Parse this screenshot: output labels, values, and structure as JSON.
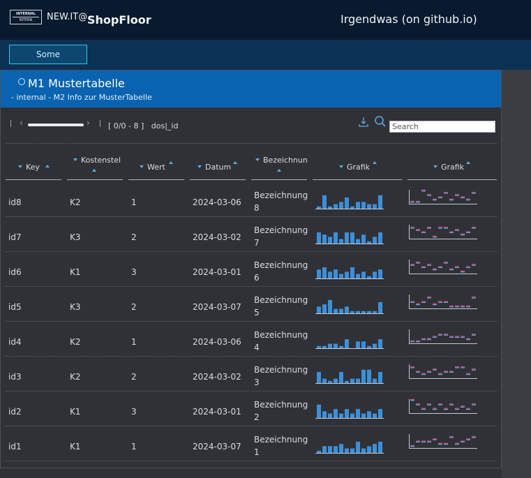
{
  "header": {
    "logo_line1": "INTERNAL",
    "logo_line2": "INTERN",
    "brand_prefix": "NEW.IT@",
    "brand_name": "ShopFloor",
    "right_title": "Irgendwas (on github.io)"
  },
  "nav": {
    "some_button": "Some"
  },
  "panel": {
    "title": "M1 Mustertabelle",
    "subtitle": "- internal - M2 Info zur MusterTabelle"
  },
  "toolbar": {
    "range": "[ 0/0 - 8 ]",
    "sort_info": "dos|_id",
    "search_placeholder": "Search",
    "search_value": ""
  },
  "columns": [
    "Key",
    "Kostenstel",
    "Wert",
    "Datum",
    "Bezeichnun",
    "Grafik",
    "Grafik"
  ],
  "colors": {
    "accent": "#0a63b0",
    "bar": "#3d8fd9",
    "marker_red": "#d94c6a",
    "marker_blue": "#6ea8ff"
  },
  "rows": [
    {
      "key": "id8",
      "kst": "K2",
      "wert": "1",
      "datum": "2024-03-06",
      "bez1": "Bezeichnung",
      "bez2": "8",
      "bars": [
        1,
        6,
        1,
        2,
        3,
        5,
        1,
        3,
        3,
        2,
        2,
        6
      ],
      "dots": [
        1,
        1,
        6,
        4,
        2,
        3,
        5,
        2,
        4,
        3,
        2,
        5
      ]
    },
    {
      "key": "id7",
      "kst": "K3",
      "wert": "2",
      "datum": "2024-03-02",
      "bez1": "Bezeichnung",
      "bez2": "7",
      "bars": [
        5,
        4,
        3,
        5,
        2,
        5,
        5,
        2,
        4,
        1,
        3,
        5
      ],
      "dots": [
        5,
        4,
        3,
        5,
        1,
        5,
        5,
        3,
        4,
        2,
        3,
        5
      ]
    },
    {
      "key": "id6",
      "kst": "K1",
      "wert": "3",
      "datum": "2024-03-01",
      "bez1": "Bezeichnung",
      "bez2": "6",
      "bars": [
        4,
        5,
        3,
        4,
        2,
        3,
        5,
        2,
        3,
        1,
        3,
        4
      ],
      "dots": [
        4,
        5,
        3,
        4,
        2,
        3,
        5,
        2,
        3,
        1,
        3,
        4
      ]
    },
    {
      "key": "id5",
      "kst": "K3",
      "wert": "2",
      "datum": "2024-03-07",
      "bez1": "Bezeichnung",
      "bez2": "5",
      "bars": [
        3,
        4,
        6,
        2,
        2,
        3,
        1,
        1,
        1,
        1,
        1,
        5
      ],
      "dots": [
        3,
        2,
        3,
        5,
        2,
        3,
        3,
        1,
        1,
        1,
        1,
        5
      ]
    },
    {
      "key": "id4",
      "kst": "K2",
      "wert": "1",
      "datum": "2024-03-06",
      "bez1": "Bezeichnung",
      "bez2": "4",
      "bars": [
        1,
        1,
        2,
        2,
        1,
        4,
        0,
        3,
        3,
        1,
        2,
        4
      ],
      "dots": [
        1,
        1,
        2,
        2,
        3,
        4,
        4,
        3,
        3,
        3,
        2,
        4
      ]
    },
    {
      "key": "id3",
      "kst": "K2",
      "wert": "2",
      "datum": "2024-03-02",
      "bez1": "Bezeichnung",
      "bez2": "3",
      "bars": [
        5,
        2,
        1,
        2,
        5,
        1,
        2,
        2,
        6,
        6,
        2,
        5
      ],
      "dots": [
        5,
        3,
        2,
        3,
        4,
        2,
        3,
        3,
        5,
        5,
        2,
        4
      ]
    },
    {
      "key": "id2",
      "kst": "K1",
      "wert": "3",
      "datum": "2024-03-01",
      "bez1": "Bezeichnung",
      "bez2": "2",
      "bars": [
        6,
        3,
        2,
        4,
        2,
        4,
        2,
        4,
        2,
        3,
        2,
        4
      ],
      "dots": [
        6,
        4,
        2,
        4,
        2,
        4,
        2,
        4,
        2,
        3,
        2,
        4
      ]
    },
    {
      "key": "id1",
      "kst": "K1",
      "wert": "1",
      "datum": "2024-03-07",
      "bez1": "Bezeichnung",
      "bez2": "1",
      "bars": [
        1,
        3,
        3,
        3,
        4,
        2,
        2,
        5,
        2,
        3,
        4,
        5
      ],
      "dots": [
        1,
        3,
        3,
        3,
        4,
        2,
        2,
        5,
        2,
        3,
        4,
        5
      ]
    }
  ]
}
